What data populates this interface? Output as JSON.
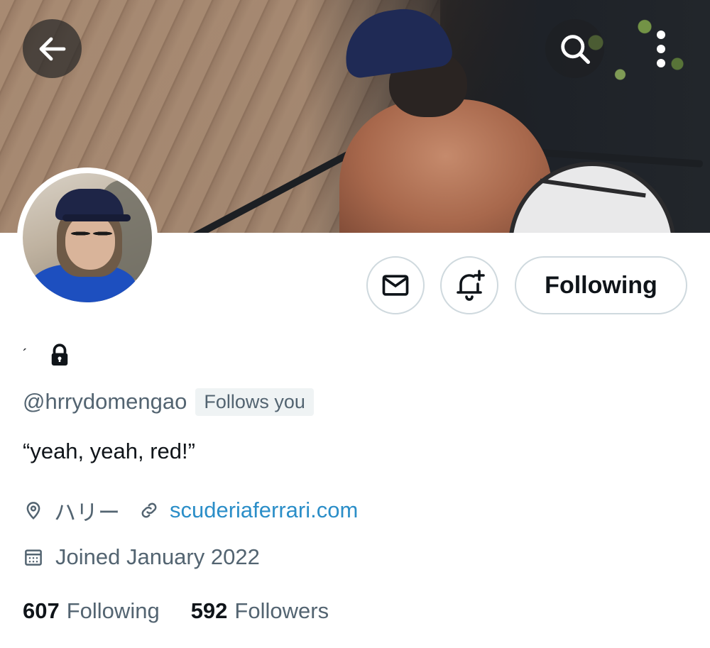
{
  "header": {
    "back_icon": "arrow-left-icon",
    "search_icon": "search-icon",
    "more_icon": "more-vertical-icon"
  },
  "actions": {
    "message_icon": "envelope-icon",
    "notify_icon": "bell-plus-icon",
    "following_label": "Following"
  },
  "profile": {
    "display_name": "´",
    "protected_icon": "lock-icon",
    "handle": "@hrrydomengao",
    "follows_you": "Follows you",
    "bio": "“yeah, yeah, red!”",
    "location": "ハリー",
    "website": "scuderiaferrari.com",
    "joined": "Joined January 2022"
  },
  "stats": {
    "following_count": "607",
    "following_label": "Following",
    "followers_count": "592",
    "followers_label": "Followers"
  },
  "colors": {
    "text": "#0f1419",
    "secondary": "#536471",
    "link": "#2b8ec8",
    "border": "#cfd9de"
  }
}
